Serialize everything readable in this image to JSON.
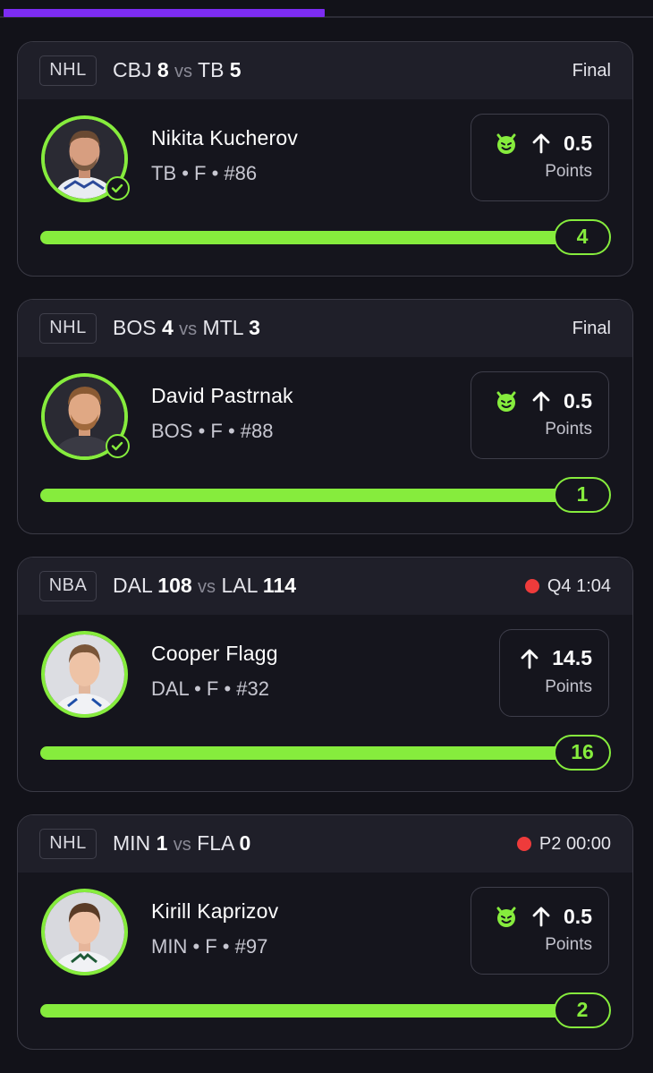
{
  "header": {
    "progress_pct": 50,
    "progress_color": "#7c2cf2"
  },
  "accent_color": "#86ec3d",
  "live_color": "#ee3b3b",
  "cards": [
    {
      "league": "NHL",
      "away_team": "CBJ",
      "away_score": "8",
      "vs": "vs",
      "home_team": "TB",
      "home_score": "5",
      "status": "Final",
      "live": false,
      "player_name": "Nikita Kucherov",
      "player_meta": "TB • F • #86",
      "checked": true,
      "demon": true,
      "direction_icon": "arrow-up-icon",
      "line": "0.5",
      "stat": "Points",
      "actual": "4",
      "progress": 1.0
    },
    {
      "league": "NHL",
      "away_team": "BOS",
      "away_score": "4",
      "vs": "vs",
      "home_team": "MTL",
      "home_score": "3",
      "status": "Final",
      "live": false,
      "player_name": "David Pastrnak",
      "player_meta": "BOS • F • #88",
      "checked": true,
      "demon": true,
      "direction_icon": "arrow-up-icon",
      "line": "0.5",
      "stat": "Points",
      "actual": "1",
      "progress": 1.0
    },
    {
      "league": "NBA",
      "away_team": "DAL",
      "away_score": "108",
      "vs": "vs",
      "home_team": "LAL",
      "home_score": "114",
      "status": "Q4 1:04",
      "live": true,
      "player_name": "Cooper Flagg",
      "player_meta": "DAL • F • #32",
      "checked": false,
      "demon": false,
      "direction_icon": "arrow-up-icon",
      "line": "14.5",
      "stat": "Points",
      "actual": "16",
      "progress": 1.0
    },
    {
      "league": "NHL",
      "away_team": "MIN",
      "away_score": "1",
      "vs": "vs",
      "home_team": "FLA",
      "home_score": "0",
      "status": "P2 00:00",
      "live": true,
      "player_name": "Kirill Kaprizov",
      "player_meta": "MIN • F • #97",
      "checked": false,
      "demon": true,
      "direction_icon": "arrow-up-icon",
      "line": "0.5",
      "stat": "Points",
      "actual": "2",
      "progress": 1.0
    }
  ]
}
